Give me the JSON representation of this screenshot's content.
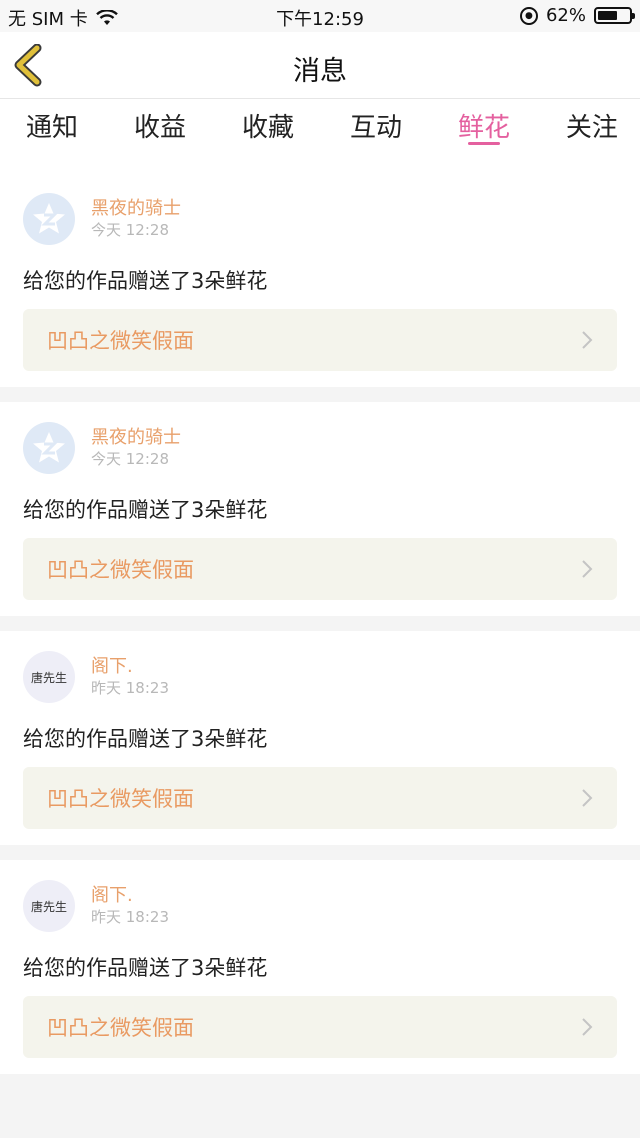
{
  "status": {
    "carrier": "无 SIM 卡",
    "time": "下午12:59",
    "battery": "62%",
    "battery_level": 0.62
  },
  "header": {
    "title": "消息"
  },
  "tabs": [
    {
      "label": "通知"
    },
    {
      "label": "收益"
    },
    {
      "label": "收藏"
    },
    {
      "label": "互动"
    },
    {
      "label": "鲜花"
    },
    {
      "label": "关注"
    }
  ],
  "messages": [
    {
      "user": "黑夜的骑士",
      "time": "今天 12:28",
      "text": "给您的作品赠送了3朵鲜花",
      "work": "凹凸之微笑假面",
      "avatar_text": ""
    },
    {
      "user": "黑夜的骑士",
      "time": "今天 12:28",
      "text": "给您的作品赠送了3朵鲜花",
      "work": "凹凸之微笑假面",
      "avatar_text": ""
    },
    {
      "user": "阁下.",
      "time": "昨天 18:23",
      "text": "给您的作品赠送了3朵鲜花",
      "work": "凹凸之微笑假面",
      "avatar_text": "唐先生"
    },
    {
      "user": "阁下.",
      "time": "昨天 18:23",
      "text": "给您的作品赠送了3朵鲜花",
      "work": "凹凸之微笑假面",
      "avatar_text": "唐先生"
    }
  ],
  "colors": {
    "accent": "#e4609f",
    "username": "#e8a06b",
    "work": "#e99a62",
    "back_icon": "#e0c03a"
  },
  "icons": {
    "back": "back-chevron-icon",
    "wifi": "wifi-icon",
    "lock": "rotation-lock-icon",
    "battery": "battery-icon",
    "qzone": "qzone-avatar-icon",
    "chevron": "chevron-right-icon"
  }
}
